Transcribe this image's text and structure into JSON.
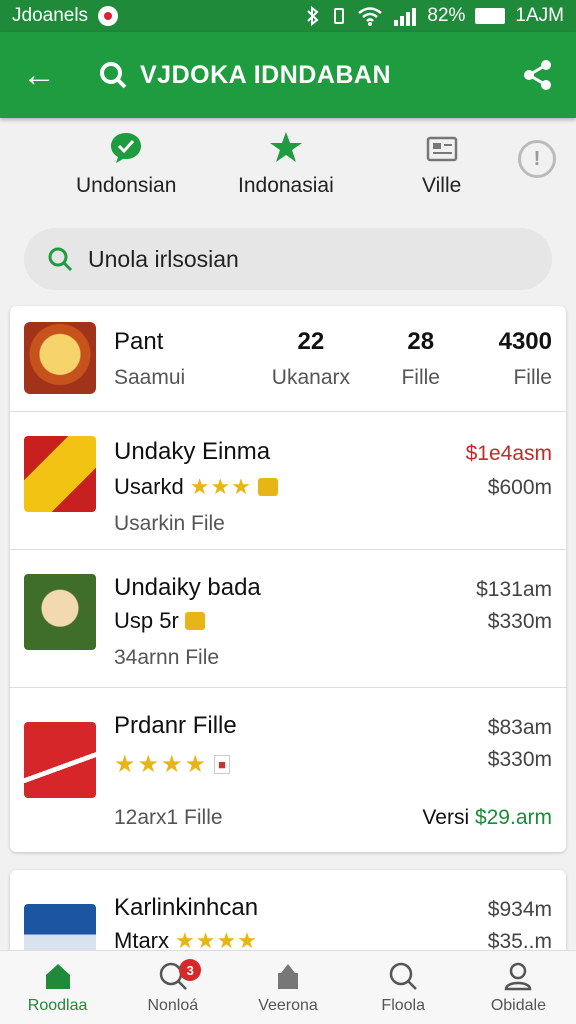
{
  "status_bar": {
    "left_text": "Jdoanels",
    "right_percent": "82%",
    "time": "1AJM"
  },
  "app_bar": {
    "title": "VJDOKA IDNDABAN"
  },
  "categories": [
    {
      "label": "Undonsian",
      "icon": "chat-bubble-icon"
    },
    {
      "label": "Indonasiai",
      "icon": "star-icon"
    },
    {
      "label": "Ville",
      "icon": "document-icon"
    }
  ],
  "help_label": "!",
  "search": {
    "value": "Unola irlsosian"
  },
  "summary": {
    "name": "Pant",
    "name_sub": "Saamui",
    "c1_value": "22",
    "c1_label": "Ukanarx",
    "c2_value": "28",
    "c2_label": "Fille",
    "c3_value": "4300",
    "c3_label": "Fille"
  },
  "items": [
    {
      "name": "Undaky Einma",
      "sub": "Usarkd",
      "file": "Usarkin File",
      "price1": "$1e4asm",
      "price2": "$600m"
    },
    {
      "name": "Undaiky bada",
      "sub": "Usp 5r",
      "file": "34arnn File",
      "price1": "$131am",
      "price2": "$330m"
    },
    {
      "name": "Prdanr Fille",
      "file": "12arx1 Fille",
      "price1": "$83am",
      "price2": "$330m",
      "versi_label": "Versi",
      "versi_price": "$29.arm"
    },
    {
      "name": "Karlinkinhcan",
      "sub": "Mtarx",
      "price1": "$934m",
      "price2": "$35..m"
    }
  ],
  "bottom_nav": [
    {
      "label": "Roodlaa",
      "icon": "home-icon"
    },
    {
      "label": "Nonloá",
      "icon": "search-notify-icon",
      "badge": "3"
    },
    {
      "label": "Veerona",
      "icon": "store-icon"
    },
    {
      "label": "Floola",
      "icon": "search-icon"
    },
    {
      "label": "Obidale",
      "icon": "profile-icon"
    }
  ],
  "colors": {
    "primary": "#1e9c3f",
    "price_red": "#c62828",
    "price_green": "#1e8a3a",
    "star": "#e8b516"
  }
}
